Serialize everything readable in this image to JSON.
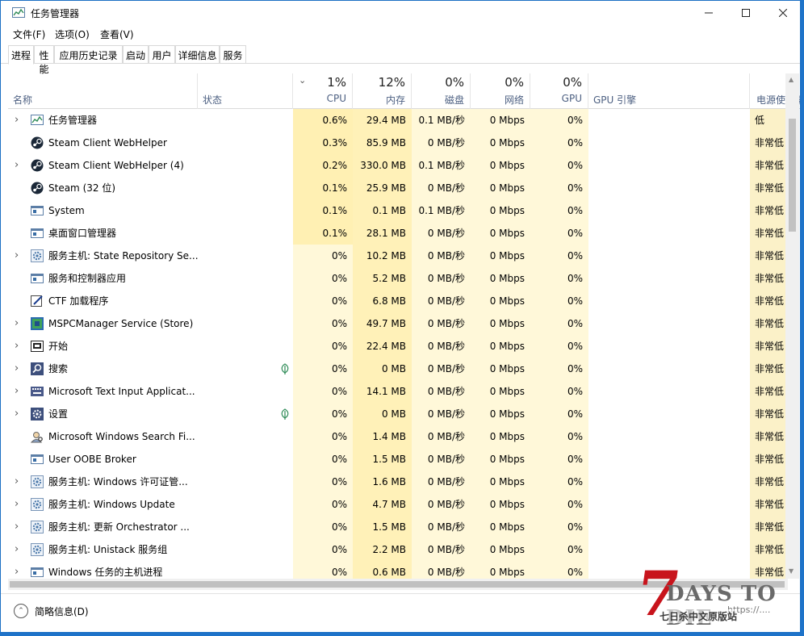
{
  "window": {
    "title": "任务管理器"
  },
  "menu": {
    "file": "文件(F)",
    "options": "选项(O)",
    "view": "查看(V)"
  },
  "tabs": [
    "进程",
    "性能",
    "应用历史记录",
    "启动",
    "用户",
    "详细信息",
    "服务"
  ],
  "columns": {
    "name": "名称",
    "status": "状态",
    "cpu": {
      "pct": "1%",
      "label": "CPU"
    },
    "memory": {
      "pct": "12%",
      "label": "内存"
    },
    "disk": {
      "pct": "0%",
      "label": "磁盘"
    },
    "network": {
      "pct": "0%",
      "label": "网络"
    },
    "gpu": {
      "pct": "0%",
      "label": "GPU"
    },
    "gpu_engine": "GPU 引擎",
    "power": "电源使用情"
  },
  "processes": [
    {
      "name": "任务管理器",
      "icon": "task-manager-icon",
      "expand": true,
      "leaf": false,
      "cpu": "0.6%",
      "mem": "29.4 MB",
      "disk": "0.1 MB/秒",
      "net": "0 Mbps",
      "gpu": "0%",
      "power": "低"
    },
    {
      "name": "Steam Client WebHelper",
      "icon": "steam-icon",
      "expand": false,
      "leaf": false,
      "cpu": "0.3%",
      "mem": "85.9 MB",
      "disk": "0 MB/秒",
      "net": "0 Mbps",
      "gpu": "0%",
      "power": "非常低"
    },
    {
      "name": "Steam Client WebHelper (4)",
      "icon": "steam-icon",
      "expand": true,
      "leaf": false,
      "cpu": "0.2%",
      "mem": "330.0 MB",
      "disk": "0.1 MB/秒",
      "net": "0 Mbps",
      "gpu": "0%",
      "power": "非常低"
    },
    {
      "name": "Steam (32 位)",
      "icon": "steam-icon",
      "expand": false,
      "leaf": false,
      "cpu": "0.1%",
      "mem": "25.9 MB",
      "disk": "0 MB/秒",
      "net": "0 Mbps",
      "gpu": "0%",
      "power": "非常低"
    },
    {
      "name": "System",
      "icon": "system-window-icon",
      "expand": false,
      "leaf": false,
      "cpu": "0.1%",
      "mem": "0.1 MB",
      "disk": "0.1 MB/秒",
      "net": "0 Mbps",
      "gpu": "0%",
      "power": "非常低"
    },
    {
      "name": "桌面窗口管理器",
      "icon": "system-window-icon",
      "expand": false,
      "leaf": false,
      "cpu": "0.1%",
      "mem": "28.1 MB",
      "disk": "0 MB/秒",
      "net": "0 Mbps",
      "gpu": "0%",
      "power": "非常低"
    },
    {
      "name": "服务主机: State Repository Se...",
      "icon": "gear-icon",
      "expand": true,
      "leaf": false,
      "cpu": "0%",
      "mem": "10.2 MB",
      "disk": "0 MB/秒",
      "net": "0 Mbps",
      "gpu": "0%",
      "power": "非常低"
    },
    {
      "name": "服务和控制器应用",
      "icon": "system-window-icon",
      "expand": false,
      "leaf": false,
      "cpu": "0%",
      "mem": "5.2 MB",
      "disk": "0 MB/秒",
      "net": "0 Mbps",
      "gpu": "0%",
      "power": "非常低"
    },
    {
      "name": "CTF 加载程序",
      "icon": "pen-icon",
      "expand": false,
      "leaf": false,
      "cpu": "0%",
      "mem": "6.8 MB",
      "disk": "0 MB/秒",
      "net": "0 Mbps",
      "gpu": "0%",
      "power": "非常低"
    },
    {
      "name": "MSPCManager Service (Store)",
      "icon": "pc-manager-icon",
      "expand": true,
      "leaf": false,
      "cpu": "0%",
      "mem": "49.7 MB",
      "disk": "0 MB/秒",
      "net": "0 Mbps",
      "gpu": "0%",
      "power": "非常低"
    },
    {
      "name": "开始",
      "icon": "start-icon",
      "expand": true,
      "leaf": false,
      "cpu": "0%",
      "mem": "22.4 MB",
      "disk": "0 MB/秒",
      "net": "0 Mbps",
      "gpu": "0%",
      "power": "非常低"
    },
    {
      "name": "搜索",
      "icon": "search-icon",
      "expand": true,
      "leaf": true,
      "cpu": "0%",
      "mem": "0 MB",
      "disk": "0 MB/秒",
      "net": "0 Mbps",
      "gpu": "0%",
      "power": "非常低"
    },
    {
      "name": "Microsoft Text Input Applicat...",
      "icon": "keyboard-icon",
      "expand": true,
      "leaf": false,
      "cpu": "0%",
      "mem": "14.1 MB",
      "disk": "0 MB/秒",
      "net": "0 Mbps",
      "gpu": "0%",
      "power": "非常低"
    },
    {
      "name": "设置",
      "icon": "settings-gear-icon",
      "expand": true,
      "leaf": true,
      "cpu": "0%",
      "mem": "0 MB",
      "disk": "0 MB/秒",
      "net": "0 Mbps",
      "gpu": "0%",
      "power": "非常低"
    },
    {
      "name": "Microsoft Windows Search Fi...",
      "icon": "search-user-icon",
      "expand": false,
      "leaf": false,
      "cpu": "0%",
      "mem": "1.4 MB",
      "disk": "0 MB/秒",
      "net": "0 Mbps",
      "gpu": "0%",
      "power": "非常低"
    },
    {
      "name": "User OOBE Broker",
      "icon": "system-window-icon",
      "expand": false,
      "leaf": false,
      "cpu": "0%",
      "mem": "1.5 MB",
      "disk": "0 MB/秒",
      "net": "0 Mbps",
      "gpu": "0%",
      "power": "非常低"
    },
    {
      "name": "服务主机: Windows 许可证管...",
      "icon": "gear-icon",
      "expand": true,
      "leaf": false,
      "cpu": "0%",
      "mem": "1.6 MB",
      "disk": "0 MB/秒",
      "net": "0 Mbps",
      "gpu": "0%",
      "power": "非常低"
    },
    {
      "name": "服务主机: Windows Update",
      "icon": "gear-icon",
      "expand": true,
      "leaf": false,
      "cpu": "0%",
      "mem": "4.7 MB",
      "disk": "0 MB/秒",
      "net": "0 Mbps",
      "gpu": "0%",
      "power": "非常低"
    },
    {
      "name": "服务主机: 更新 Orchestrator ...",
      "icon": "gear-icon",
      "expand": true,
      "leaf": false,
      "cpu": "0%",
      "mem": "1.5 MB",
      "disk": "0 MB/秒",
      "net": "0 Mbps",
      "gpu": "0%",
      "power": "非常低"
    },
    {
      "name": "服务主机: Unistack 服务组",
      "icon": "gear-icon",
      "expand": true,
      "leaf": false,
      "cpu": "0%",
      "mem": "2.2 MB",
      "disk": "0 MB/秒",
      "net": "0 Mbps",
      "gpu": "0%",
      "power": "非常低"
    },
    {
      "name": "Windows 任务的主机进程",
      "icon": "system-window-icon",
      "expand": true,
      "leaf": false,
      "cpu": "0%",
      "mem": "0.6 MB",
      "disk": "0 MB/秒",
      "net": "0 Mbps",
      "gpu": "0%",
      "power": "非常低"
    }
  ],
  "footer": {
    "label": "简略信息(D)"
  },
  "watermark": {
    "number": "7",
    "title": "DAYS TO DIE",
    "subtitle": "七日杀中文原版站",
    "site": "https://...."
  },
  "colors": {
    "heat_high": "#fff0b3",
    "heat_low": "#fff8d9",
    "heat_mem": "#fff1b8",
    "power_cell": "#fbf1c8",
    "accent": "#1b6fc4"
  }
}
